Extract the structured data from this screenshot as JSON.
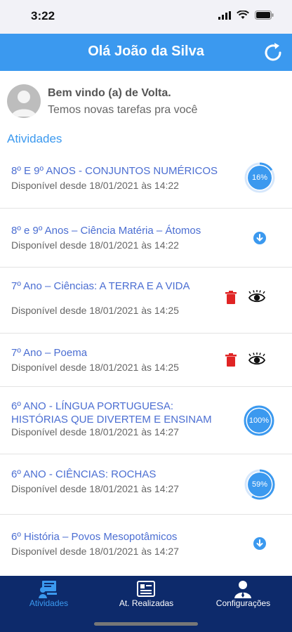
{
  "status_bar": {
    "time": "3:22"
  },
  "header": {
    "title": "Olá João da Silva",
    "refresh_icon": "refresh-icon"
  },
  "welcome": {
    "title": "Bem vindo (a) de Volta.",
    "subtitle": "Temos novas tarefas pra você"
  },
  "section": {
    "title": "Atividades"
  },
  "activities": [
    {
      "title": "8º E 9º ANOS - CONJUNTOS NUMÉRICOS",
      "date": "Disponível desde 18/01/2021 às 14:22",
      "status": "progress",
      "progress_label": "16%",
      "progress": 0.16
    },
    {
      "title": "8º e 9º Anos – Ciência Matéria – Átomos",
      "date": "Disponível desde 18/01/2021 às 14:22",
      "status": "download"
    },
    {
      "title": "7º Ano – Ciências: A TERRA E A VIDA",
      "date": "Disponível desde 18/01/2021 às 14:25",
      "status": "downloaded"
    },
    {
      "title": "7º Ano – Poema",
      "date": "Disponível desde 18/01/2021 às 14:25",
      "status": "downloaded"
    },
    {
      "title": "6º ANO - LÍNGUA PORTUGUESA: HISTÓRIAS QUE DIVERTEM E ENSINAM",
      "date": "Disponível desde 18/01/2021 às 14:27",
      "status": "progress",
      "progress_label": "100%",
      "progress": 1.0
    },
    {
      "title": "6º ANO - CIÊNCIAS: ROCHAS",
      "date": "Disponível desde 18/01/2021 às 14:27",
      "status": "progress",
      "progress_label": "59%",
      "progress": 0.59
    },
    {
      "title": "6º História – Povos Mesopotâmicos",
      "date": "Disponível desde 18/01/2021 às 14:27",
      "status": "download"
    }
  ],
  "tabs": [
    {
      "label": "Atividades",
      "icon": "activities-icon",
      "active": true
    },
    {
      "label": "At. Realizadas",
      "icon": "completed-list-icon",
      "active": false
    },
    {
      "label": "Configurações",
      "icon": "user-settings-icon",
      "active": false
    }
  ],
  "colors": {
    "primary": "#3b99ef",
    "title_text": "#4b6ed2",
    "tab_bar": "#0d2a6b",
    "delete": "#e02424"
  }
}
